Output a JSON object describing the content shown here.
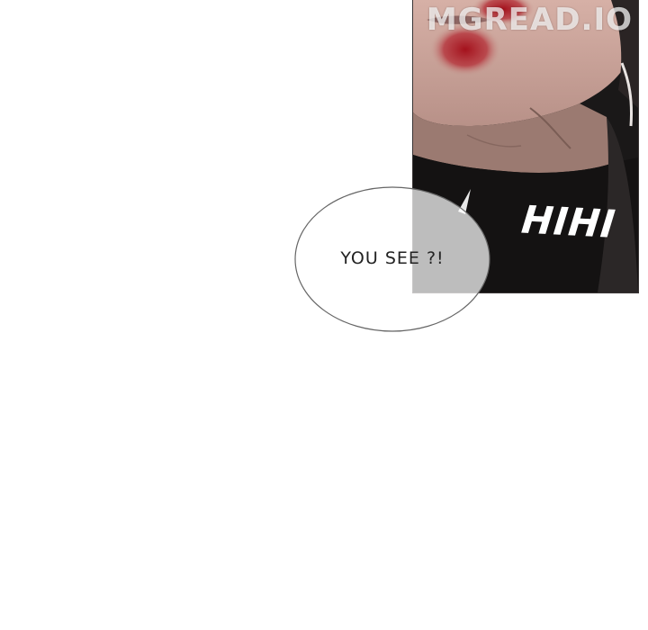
{
  "watermark": "MGREAD.IO",
  "sound_effect": "HIHI",
  "speech_bubble": "YOU SEE ?!",
  "colors": {
    "skin": "#c9a59a",
    "blood": "#b0202a",
    "clothing": "#141212",
    "page_background": "#ffffff"
  }
}
